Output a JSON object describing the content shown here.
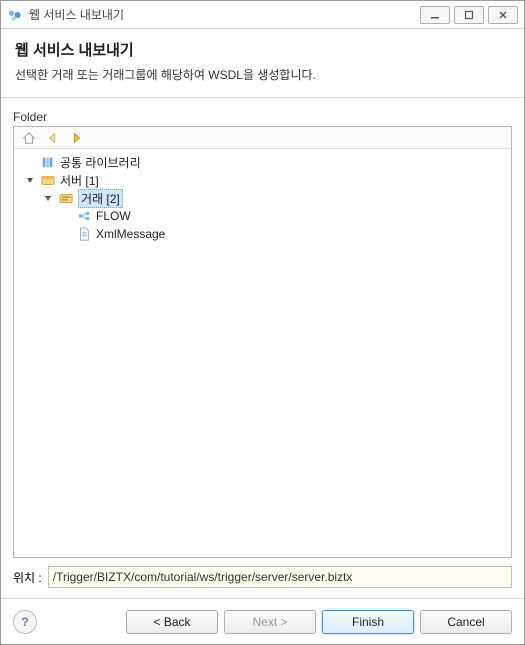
{
  "window": {
    "title": "웹 서비스 내보내기"
  },
  "header": {
    "title": "웹 서비스 내보내기",
    "description": "선택한 거래 또는 거래그룹에 해당하여 WSDL을 생성합니다."
  },
  "content": {
    "folder_label": "Folder",
    "location_label": "위치 :",
    "location_value": "/Trigger/BIZTX/com/tutorial/ws/trigger/server/server.biztx"
  },
  "tree": {
    "nodes": [
      {
        "id": "lib",
        "label": "공통 라이브러리",
        "level": 0,
        "expandable": false,
        "selected": false,
        "icon": "library"
      },
      {
        "id": "server",
        "label": "서버 [1]",
        "level": 0,
        "expandable": true,
        "expanded": true,
        "selected": false,
        "icon": "server"
      },
      {
        "id": "tx",
        "label": "거래 [2]",
        "level": 1,
        "expandable": true,
        "expanded": true,
        "selected": true,
        "icon": "transaction"
      },
      {
        "id": "flow",
        "label": "FLOW",
        "level": 2,
        "expandable": false,
        "selected": false,
        "icon": "flow"
      },
      {
        "id": "xml",
        "label": "XmlMessage",
        "level": 2,
        "expandable": false,
        "selected": false,
        "icon": "document"
      }
    ]
  },
  "buttons": {
    "back": "< Back",
    "next": "Next >",
    "finish": "Finish",
    "cancel": "Cancel"
  }
}
